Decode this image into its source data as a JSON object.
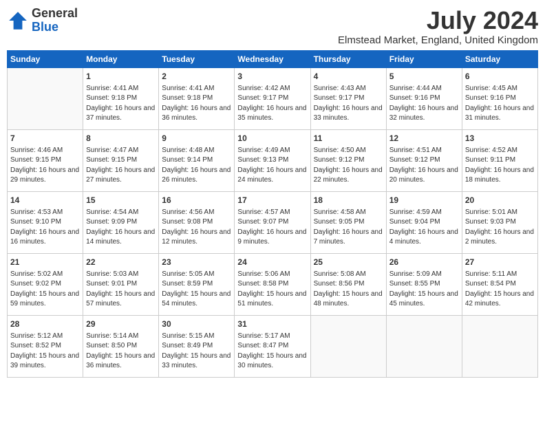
{
  "logo": {
    "text_general": "General",
    "text_blue": "Blue"
  },
  "title": "July 2024",
  "location": "Elmstead Market, England, United Kingdom",
  "weekdays": [
    "Sunday",
    "Monday",
    "Tuesday",
    "Wednesday",
    "Thursday",
    "Friday",
    "Saturday"
  ],
  "weeks": [
    [
      {
        "day": "",
        "sunrise": "",
        "sunset": "",
        "daylight": ""
      },
      {
        "day": "1",
        "sunrise": "Sunrise: 4:41 AM",
        "sunset": "Sunset: 9:18 PM",
        "daylight": "Daylight: 16 hours and 37 minutes."
      },
      {
        "day": "2",
        "sunrise": "Sunrise: 4:41 AM",
        "sunset": "Sunset: 9:18 PM",
        "daylight": "Daylight: 16 hours and 36 minutes."
      },
      {
        "day": "3",
        "sunrise": "Sunrise: 4:42 AM",
        "sunset": "Sunset: 9:17 PM",
        "daylight": "Daylight: 16 hours and 35 minutes."
      },
      {
        "day": "4",
        "sunrise": "Sunrise: 4:43 AM",
        "sunset": "Sunset: 9:17 PM",
        "daylight": "Daylight: 16 hours and 33 minutes."
      },
      {
        "day": "5",
        "sunrise": "Sunrise: 4:44 AM",
        "sunset": "Sunset: 9:16 PM",
        "daylight": "Daylight: 16 hours and 32 minutes."
      },
      {
        "day": "6",
        "sunrise": "Sunrise: 4:45 AM",
        "sunset": "Sunset: 9:16 PM",
        "daylight": "Daylight: 16 hours and 31 minutes."
      }
    ],
    [
      {
        "day": "7",
        "sunrise": "Sunrise: 4:46 AM",
        "sunset": "Sunset: 9:15 PM",
        "daylight": "Daylight: 16 hours and 29 minutes."
      },
      {
        "day": "8",
        "sunrise": "Sunrise: 4:47 AM",
        "sunset": "Sunset: 9:15 PM",
        "daylight": "Daylight: 16 hours and 27 minutes."
      },
      {
        "day": "9",
        "sunrise": "Sunrise: 4:48 AM",
        "sunset": "Sunset: 9:14 PM",
        "daylight": "Daylight: 16 hours and 26 minutes."
      },
      {
        "day": "10",
        "sunrise": "Sunrise: 4:49 AM",
        "sunset": "Sunset: 9:13 PM",
        "daylight": "Daylight: 16 hours and 24 minutes."
      },
      {
        "day": "11",
        "sunrise": "Sunrise: 4:50 AM",
        "sunset": "Sunset: 9:12 PM",
        "daylight": "Daylight: 16 hours and 22 minutes."
      },
      {
        "day": "12",
        "sunrise": "Sunrise: 4:51 AM",
        "sunset": "Sunset: 9:12 PM",
        "daylight": "Daylight: 16 hours and 20 minutes."
      },
      {
        "day": "13",
        "sunrise": "Sunrise: 4:52 AM",
        "sunset": "Sunset: 9:11 PM",
        "daylight": "Daylight: 16 hours and 18 minutes."
      }
    ],
    [
      {
        "day": "14",
        "sunrise": "Sunrise: 4:53 AM",
        "sunset": "Sunset: 9:10 PM",
        "daylight": "Daylight: 16 hours and 16 minutes."
      },
      {
        "day": "15",
        "sunrise": "Sunrise: 4:54 AM",
        "sunset": "Sunset: 9:09 PM",
        "daylight": "Daylight: 16 hours and 14 minutes."
      },
      {
        "day": "16",
        "sunrise": "Sunrise: 4:56 AM",
        "sunset": "Sunset: 9:08 PM",
        "daylight": "Daylight: 16 hours and 12 minutes."
      },
      {
        "day": "17",
        "sunrise": "Sunrise: 4:57 AM",
        "sunset": "Sunset: 9:07 PM",
        "daylight": "Daylight: 16 hours and 9 minutes."
      },
      {
        "day": "18",
        "sunrise": "Sunrise: 4:58 AM",
        "sunset": "Sunset: 9:05 PM",
        "daylight": "Daylight: 16 hours and 7 minutes."
      },
      {
        "day": "19",
        "sunrise": "Sunrise: 4:59 AM",
        "sunset": "Sunset: 9:04 PM",
        "daylight": "Daylight: 16 hours and 4 minutes."
      },
      {
        "day": "20",
        "sunrise": "Sunrise: 5:01 AM",
        "sunset": "Sunset: 9:03 PM",
        "daylight": "Daylight: 16 hours and 2 minutes."
      }
    ],
    [
      {
        "day": "21",
        "sunrise": "Sunrise: 5:02 AM",
        "sunset": "Sunset: 9:02 PM",
        "daylight": "Daylight: 15 hours and 59 minutes."
      },
      {
        "day": "22",
        "sunrise": "Sunrise: 5:03 AM",
        "sunset": "Sunset: 9:01 PM",
        "daylight": "Daylight: 15 hours and 57 minutes."
      },
      {
        "day": "23",
        "sunrise": "Sunrise: 5:05 AM",
        "sunset": "Sunset: 8:59 PM",
        "daylight": "Daylight: 15 hours and 54 minutes."
      },
      {
        "day": "24",
        "sunrise": "Sunrise: 5:06 AM",
        "sunset": "Sunset: 8:58 PM",
        "daylight": "Daylight: 15 hours and 51 minutes."
      },
      {
        "day": "25",
        "sunrise": "Sunrise: 5:08 AM",
        "sunset": "Sunset: 8:56 PM",
        "daylight": "Daylight: 15 hours and 48 minutes."
      },
      {
        "day": "26",
        "sunrise": "Sunrise: 5:09 AM",
        "sunset": "Sunset: 8:55 PM",
        "daylight": "Daylight: 15 hours and 45 minutes."
      },
      {
        "day": "27",
        "sunrise": "Sunrise: 5:11 AM",
        "sunset": "Sunset: 8:54 PM",
        "daylight": "Daylight: 15 hours and 42 minutes."
      }
    ],
    [
      {
        "day": "28",
        "sunrise": "Sunrise: 5:12 AM",
        "sunset": "Sunset: 8:52 PM",
        "daylight": "Daylight: 15 hours and 39 minutes."
      },
      {
        "day": "29",
        "sunrise": "Sunrise: 5:14 AM",
        "sunset": "Sunset: 8:50 PM",
        "daylight": "Daylight: 15 hours and 36 minutes."
      },
      {
        "day": "30",
        "sunrise": "Sunrise: 5:15 AM",
        "sunset": "Sunset: 8:49 PM",
        "daylight": "Daylight: 15 hours and 33 minutes."
      },
      {
        "day": "31",
        "sunrise": "Sunrise: 5:17 AM",
        "sunset": "Sunset: 8:47 PM",
        "daylight": "Daylight: 15 hours and 30 minutes."
      },
      {
        "day": "",
        "sunrise": "",
        "sunset": "",
        "daylight": ""
      },
      {
        "day": "",
        "sunrise": "",
        "sunset": "",
        "daylight": ""
      },
      {
        "day": "",
        "sunrise": "",
        "sunset": "",
        "daylight": ""
      }
    ]
  ]
}
